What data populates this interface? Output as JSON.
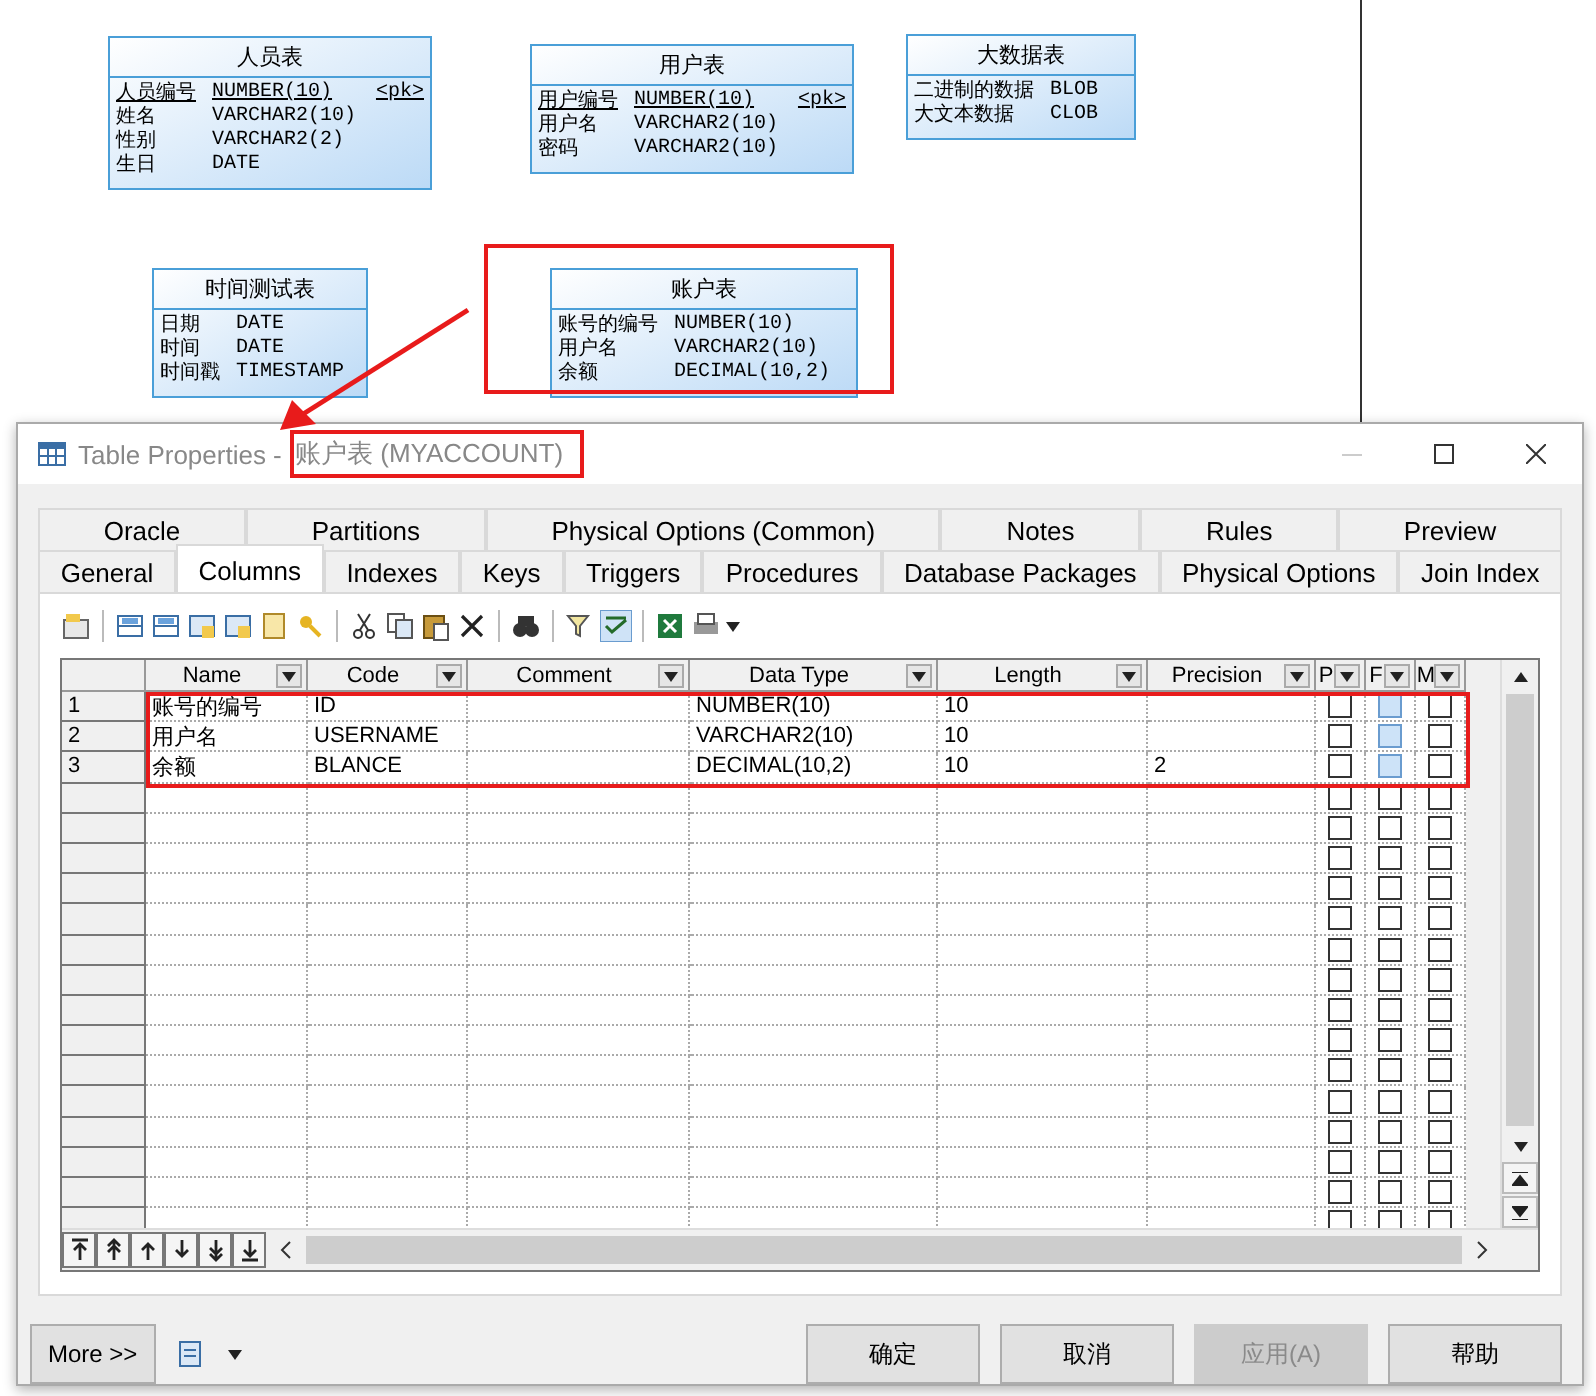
{
  "diagram": {
    "entities": [
      {
        "title": "人员表",
        "columns": [
          {
            "name": "人员编号",
            "type": "NUMBER(10)",
            "pk": "<pk>"
          },
          {
            "name": "姓名",
            "type": "VARCHAR2(10)"
          },
          {
            "name": "性别",
            "type": "VARCHAR2(2)"
          },
          {
            "name": "生日",
            "type": "DATE"
          }
        ]
      },
      {
        "title": "用户表",
        "columns": [
          {
            "name": "用户编号",
            "type": "NUMBER(10)",
            "pk": "<pk>"
          },
          {
            "name": "用户名",
            "type": "VARCHAR2(10)"
          },
          {
            "name": "密码",
            "type": "VARCHAR2(10)"
          }
        ]
      },
      {
        "title": "大数据表",
        "columns": [
          {
            "name": "二进制的数据",
            "type": "BLOB"
          },
          {
            "name": "大文本数据",
            "type": "CLOB"
          }
        ]
      },
      {
        "title": "时间测试表",
        "columns": [
          {
            "name": "日期",
            "type": "DATE"
          },
          {
            "name": "时间",
            "type": "DATE"
          },
          {
            "name": "时间戳",
            "type": "TIMESTAMP"
          }
        ]
      },
      {
        "title": "账户表",
        "columns": [
          {
            "name": "账号的编号",
            "type": "NUMBER(10)"
          },
          {
            "name": "用户名",
            "type": "VARCHAR2(10)"
          },
          {
            "name": "余额",
            "type": "DECIMAL(10,2)"
          }
        ]
      }
    ]
  },
  "dialog": {
    "title": "Table Properties - ",
    "title_highlight": "账户表 (MYACCOUNT)",
    "tabs_back": [
      {
        "label": "Oracle",
        "selected": false
      },
      {
        "label": "Partitions",
        "selected": false
      },
      {
        "label": "Physical Options (Common)",
        "selected": false
      },
      {
        "label": "Notes",
        "selected": false
      },
      {
        "label": "Rules",
        "selected": false
      },
      {
        "label": "Preview",
        "selected": false
      }
    ],
    "tabs_front": [
      {
        "label": "General",
        "selected": false
      },
      {
        "label": "Columns",
        "selected": true
      },
      {
        "label": "Indexes",
        "selected": false
      },
      {
        "label": "Keys",
        "selected": false
      },
      {
        "label": "Triggers",
        "selected": false
      },
      {
        "label": "Procedures",
        "selected": false
      },
      {
        "label": "Database Packages",
        "selected": false
      },
      {
        "label": "Physical Options",
        "selected": false
      },
      {
        "label": "Join Index",
        "selected": false
      }
    ],
    "table": {
      "columns": [
        "Name",
        "Code",
        "Comment",
        "Data Type",
        "Length",
        "Precision",
        "P",
        "F",
        "M"
      ],
      "rows": [
        {
          "number": "1",
          "cells": [
            "账号的编号",
            "ID",
            "",
            "NUMBER(10)",
            "10",
            ""
          ],
          "checks": [
            {
              "checked": false,
              "disabled": false
            },
            {
              "checked": false,
              "disabled": true
            },
            {
              "checked": false,
              "disabled": false
            }
          ]
        },
        {
          "number": "2",
          "cells": [
            "用户名",
            "USERNAME",
            "",
            "VARCHAR2(10)",
            "10",
            ""
          ],
          "checks": [
            {
              "checked": false,
              "disabled": false
            },
            {
              "checked": false,
              "disabled": true
            },
            {
              "checked": false,
              "disabled": false
            }
          ]
        },
        {
          "number": "3",
          "cells": [
            "余额",
            "BLANCE",
            "",
            "DECIMAL(10,2)",
            "10",
            "2"
          ],
          "checks": [
            {
              "checked": false,
              "disabled": false
            },
            {
              "checked": false,
              "disabled": true
            },
            {
              "checked": false,
              "disabled": false
            }
          ]
        }
      ]
    },
    "empty_rows": [
      {
        "checks": [
          {
            "checked": false
          },
          {
            "checked": false
          },
          {
            "checked": false
          }
        ]
      },
      {
        "checks": [
          {
            "checked": false
          },
          {
            "checked": false
          },
          {
            "checked": false
          }
        ]
      },
      {
        "checks": [
          {
            "checked": false
          },
          {
            "checked": false
          },
          {
            "checked": false
          }
        ]
      },
      {
        "checks": [
          {
            "checked": false
          },
          {
            "checked": false
          },
          {
            "checked": false
          }
        ]
      },
      {
        "checks": [
          {
            "checked": false
          },
          {
            "checked": false
          },
          {
            "checked": false
          }
        ]
      },
      {
        "checks": [
          {
            "checked": false
          },
          {
            "checked": false
          },
          {
            "checked": false
          }
        ]
      },
      {
        "checks": [
          {
            "checked": false
          },
          {
            "checked": false
          },
          {
            "checked": false
          }
        ]
      },
      {
        "checks": [
          {
            "checked": false
          },
          {
            "checked": false
          },
          {
            "checked": false
          }
        ]
      },
      {
        "checks": [
          {
            "checked": false
          },
          {
            "checked": false
          },
          {
            "checked": false
          }
        ]
      },
      {
        "checks": [
          {
            "checked": false
          },
          {
            "checked": false
          },
          {
            "checked": false
          }
        ]
      },
      {
        "checks": [
          {
            "checked": false
          },
          {
            "checked": false
          },
          {
            "checked": false
          }
        ]
      },
      {
        "checks": [
          {
            "checked": false
          },
          {
            "checked": false
          },
          {
            "checked": false
          }
        ]
      },
      {
        "checks": [
          {
            "checked": false
          },
          {
            "checked": false
          },
          {
            "checked": false
          }
        ]
      },
      {
        "checks": [
          {
            "checked": false
          },
          {
            "checked": false
          },
          {
            "checked": false
          }
        ]
      },
      {
        "checks": [
          {
            "checked": false
          },
          {
            "checked": false
          },
          {
            "checked": false
          }
        ]
      }
    ],
    "more_button": "More >>",
    "buttons": [
      {
        "label": "确定",
        "disabled": false
      },
      {
        "label": "取消",
        "disabled": false
      },
      {
        "label": "应用(A)",
        "disabled": true
      },
      {
        "label": "帮助",
        "disabled": false
      }
    ]
  }
}
